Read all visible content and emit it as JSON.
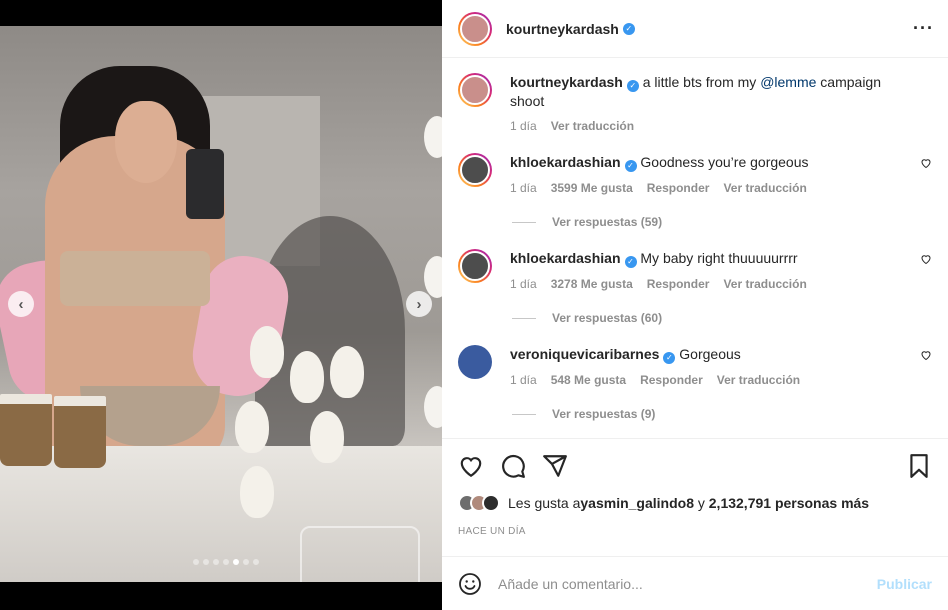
{
  "post": {
    "author": "kourtneykardash",
    "caption_pre": "a little bts from my ",
    "caption_mention": "@lemme",
    "caption_post": " campaign shoot",
    "caption_time": "1 día",
    "caption_translate": "Ver traducción"
  },
  "comments": [
    {
      "user": "khloekardashian",
      "text": "Goodness you’re gorgeous",
      "time": "1 día",
      "likes": "3599 Me gusta",
      "reply": "Responder",
      "translate": "Ver traducción",
      "view_replies": "Ver respuestas (59)"
    },
    {
      "user": "khloekardashian",
      "text": "My baby right thuuuuurrrr",
      "time": "1 día",
      "likes": "3278 Me gusta",
      "reply": "Responder",
      "translate": "Ver traducción",
      "view_replies": "Ver respuestas (60)"
    },
    {
      "user": "veroniquevicaribarnes",
      "text": "Gorgeous",
      "time": "1 día",
      "likes": "548 Me gusta",
      "reply": "Responder",
      "translate": "Ver traducción",
      "view_replies": "Ver respuestas (9)"
    }
  ],
  "likes_summary": {
    "prefix": "Les gusta a ",
    "user": "yasmin_galindo8",
    "middle": " y ",
    "count": "2,132,791 personas más"
  },
  "timestamp": "HACE UN DÍA",
  "composer": {
    "placeholder": "Añade un comentario...",
    "post_label": "Publicar"
  },
  "carousel": {
    "total": 7,
    "active": 5
  },
  "colors": {
    "verified": "#3897f0",
    "post_disabled": "#b2dffc",
    "mention": "#00376b"
  },
  "icons": [
    "heart-icon",
    "comment-icon",
    "share-icon",
    "bookmark-icon",
    "emoji-icon",
    "more-icon",
    "chevron-left-icon",
    "chevron-right-icon"
  ]
}
